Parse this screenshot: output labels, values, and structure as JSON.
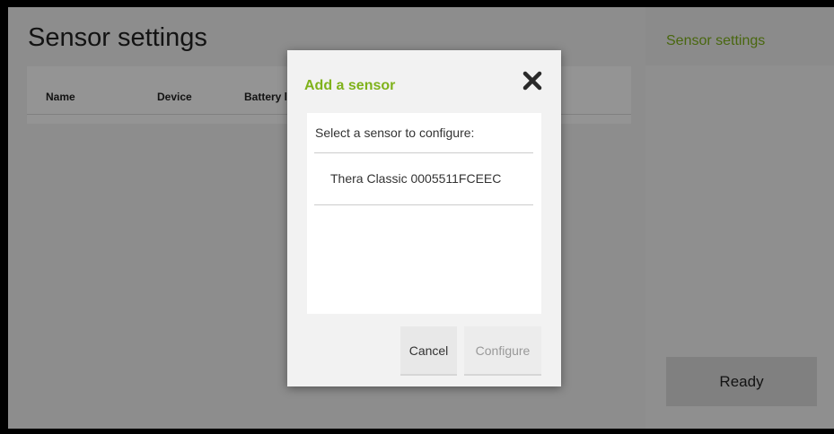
{
  "main": {
    "title": "Sensor settings",
    "table": {
      "columns": [
        "Name",
        "Device",
        "Battery l"
      ]
    }
  },
  "sidebar": {
    "title": "Sensor settings",
    "ready_label": "Ready"
  },
  "dialog": {
    "title": "Add a sensor",
    "list_label": "Select a sensor to configure:",
    "sensors": [
      "Thera Classic 0005511FCEEC"
    ],
    "cancel_label": "Cancel",
    "configure_label": "Configure"
  },
  "colors": {
    "accent": "#7fb21b",
    "overlay": "rgba(0,0,0,0.42)"
  },
  "icons": {
    "close": "close-icon"
  }
}
